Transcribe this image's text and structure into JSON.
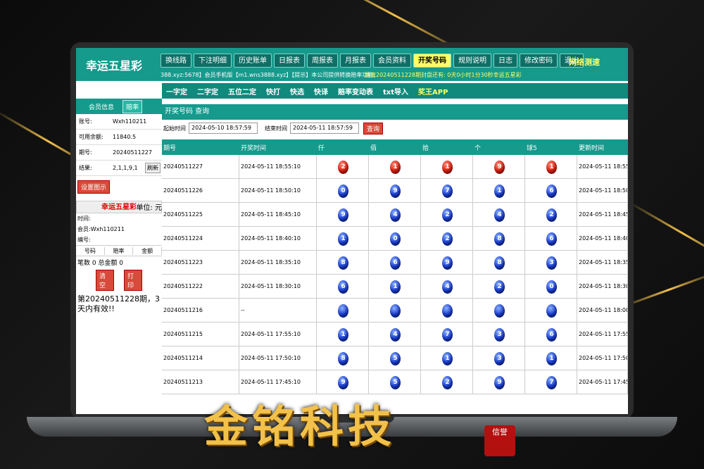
{
  "app": {
    "title": "幸运五星彩",
    "nav": [
      "换线路",
      "下注明细",
      "历史账单",
      "日报表",
      "周报表",
      "月报表",
      "会员资料",
      "开奖号码",
      "规则说明",
      "日志",
      "修改密码",
      "退出"
    ],
    "nav_active": "开奖号码",
    "network_test": "网络测速",
    "ticker": "388.xyz:5678】会员手机版【m1.wns3888.xyz】【提示】本公司提供转换赔率功能,",
    "countdown": "距离20240511228期封盘还有: 0天0小时1分30秒幸运五星彩"
  },
  "subnav": [
    "一字定",
    "二字定",
    "五位二定",
    "快打",
    "快选",
    "快译",
    "赔率变动表",
    "txt导入",
    "奖王APP"
  ],
  "sidebar": {
    "tabs": [
      "会员信息",
      "赔率"
    ],
    "account_label": "账号:",
    "account": "Wxh110211",
    "balance_label": "可用余额:",
    "balance": "11840.5",
    "period_label": "期号:",
    "period": "20240511227",
    "result_label": "结果:",
    "result": "2,1,1,9,1",
    "refresh": "刷新",
    "settings_btn": "设置图示",
    "unit": "单位: 元",
    "section_title": "幸运五星彩",
    "time_label": "时间:",
    "member_label": "会员:Wxh110211",
    "serial_label": "编号:",
    "cols": [
      "号码",
      "赔率",
      "金额"
    ],
    "totals": "笔数 0 总金额 0",
    "clear": "清空",
    "print": "打印",
    "notice": "第20240511228期，3天内有效!!"
  },
  "panel": {
    "title": "开奖号码 查询",
    "start_label": "起始时间",
    "start_value": "2024-05-10 18:57:59",
    "end_label": "结束时间",
    "end_value": "2024-05-11 18:57:59",
    "query_btn": "查询"
  },
  "table": {
    "headers": [
      "期号",
      "开奖时间",
      "仟",
      "佰",
      "拾",
      "个",
      "球5",
      "更新时间"
    ],
    "rows": [
      {
        "period": "20240511227",
        "time": "2024-05-11 18:55:10",
        "balls": [
          "2",
          "1",
          "1",
          "9",
          "1"
        ],
        "color": "red",
        "updated": "2024-05-11 18:55:12"
      },
      {
        "period": "20240511226",
        "time": "2024-05-11 18:50:10",
        "balls": [
          "0",
          "9",
          "7",
          "1",
          "6"
        ],
        "color": "blue",
        "updated": "2024-05-11 18:50:13"
      },
      {
        "period": "20240511225",
        "time": "2024-05-11 18:45:10",
        "balls": [
          "9",
          "4",
          "2",
          "4",
          "2"
        ],
        "color": "blue",
        "updated": "2024-05-11 18:45:11"
      },
      {
        "period": "20240511224",
        "time": "2024-05-11 18:40:10",
        "balls": [
          "1",
          "0",
          "2",
          "8",
          "6"
        ],
        "color": "blue",
        "updated": "2024-05-11 18:40:11"
      },
      {
        "period": "20240511223",
        "time": "2024-05-11 18:35:10",
        "balls": [
          "8",
          "6",
          "9",
          "8",
          "3"
        ],
        "color": "blue",
        "updated": "2024-05-11 18:35:12"
      },
      {
        "period": "20240511222",
        "time": "2024-05-11 18:30:10",
        "balls": [
          "6",
          "1",
          "4",
          "2",
          "0"
        ],
        "color": "blue",
        "updated": "2024-05-11 18:30:11"
      },
      {
        "period": "20240511216",
        "time": "--",
        "balls": [
          "",
          "",
          "",
          "",
          ""
        ],
        "color": "blue",
        "updated": "2024-05-11 18:00:16"
      },
      {
        "period": "20240511215",
        "time": "2024-05-11 17:55:10",
        "balls": [
          "1",
          "4",
          "7",
          "3",
          "6"
        ],
        "color": "blue",
        "updated": "2024-05-11 17:55:11"
      },
      {
        "period": "20240511214",
        "time": "2024-05-11 17:50:10",
        "balls": [
          "8",
          "5",
          "1",
          "3",
          "1"
        ],
        "color": "blue",
        "updated": "2024-05-11 17:50:14"
      },
      {
        "period": "20240511213",
        "time": "2024-05-11 17:45:10",
        "balls": [
          "9",
          "5",
          "2",
          "9",
          "7"
        ],
        "color": "blue",
        "updated": "2024-05-11 17:45:14"
      }
    ]
  },
  "brand": {
    "name": "金铭科技",
    "seal": "信誉"
  }
}
